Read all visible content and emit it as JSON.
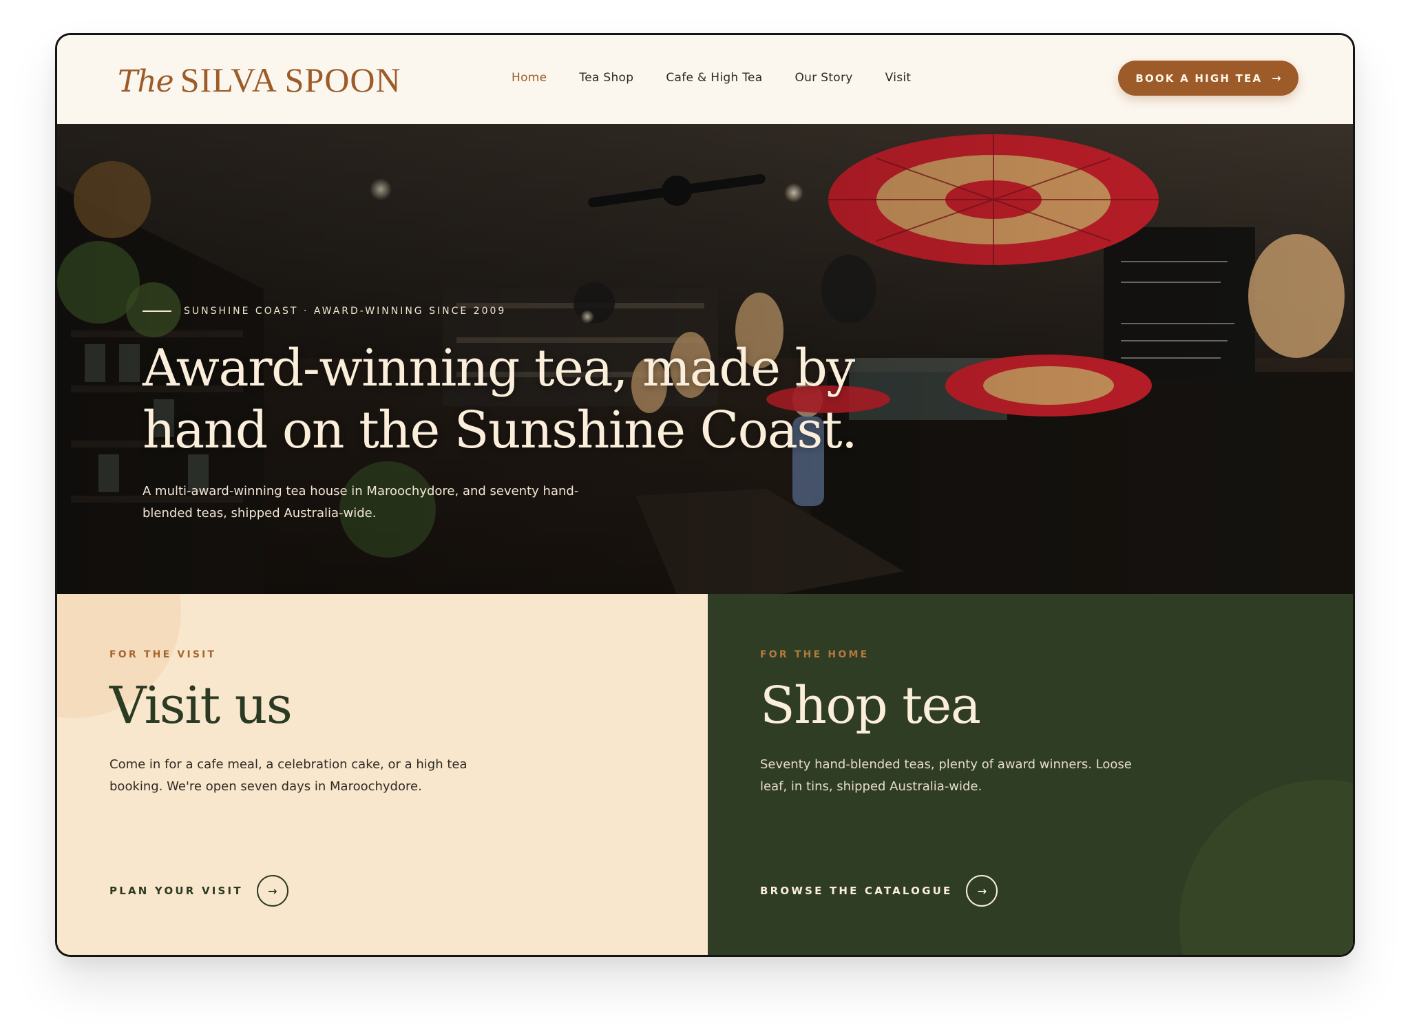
{
  "brand": {
    "logo_script": "The",
    "logo_main": "SILVA SPOON",
    "accent": "#9c5b28",
    "dark_green": "#2f3d25",
    "cream": "#f8e7cd"
  },
  "nav": {
    "items": [
      {
        "label": "Home",
        "active": true
      },
      {
        "label": "Tea Shop"
      },
      {
        "label": "Cafe & High Tea"
      },
      {
        "label": "Our Story"
      },
      {
        "label": "Visit"
      }
    ],
    "cta_label": "BOOK A HIGH TEA",
    "cta_icon": "arrow-right-icon"
  },
  "hero": {
    "eyebrow": "SUNSHINE COAST · AWARD-WINNING SINCE 2009",
    "title": "Award-winning tea, made by hand on the Sunshine Coast.",
    "subtitle": "A multi-award-winning tea house in Maroochydore, and seventy hand-blended teas, shipped Australia-wide.",
    "image": "tea-house-interior-photo"
  },
  "panels": {
    "visit": {
      "kicker": "FOR THE VISIT",
      "title": "Visit us",
      "body": "Come in for a cafe meal, a celebration cake, or a high tea booking. We're open seven days in Maroochydore.",
      "cta": "PLAN YOUR VISIT",
      "cta_icon": "arrow-right-icon"
    },
    "shop": {
      "kicker": "FOR THE HOME",
      "title": "Shop tea",
      "body": "Seventy hand-blended teas, plenty of award winners. Loose leaf, in tins, shipped Australia-wide.",
      "cta": "BROWSE THE CATALOGUE",
      "cta_icon": "arrow-right-icon"
    }
  }
}
